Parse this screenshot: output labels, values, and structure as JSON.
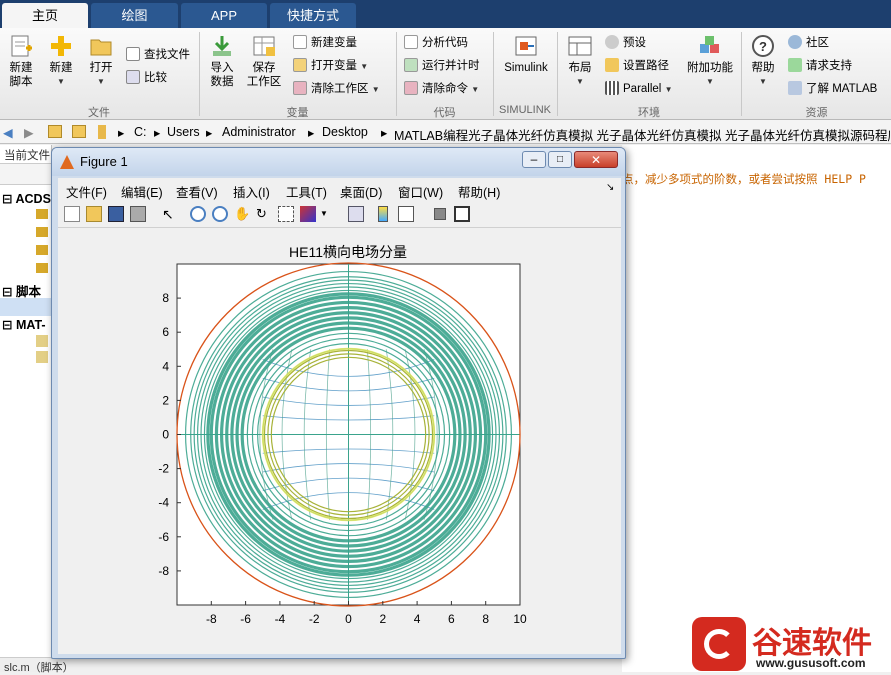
{
  "tabs": [
    "主页",
    "绘图",
    "APP",
    "快捷方式"
  ],
  "ribbon": {
    "new_script": "新建\n脚本",
    "new": "新建",
    "open": "打开",
    "find_files": "查找文件",
    "compare": "比较",
    "import_data": "导入\n数据",
    "save_workspace": "保存\n工作区",
    "new_variable": "新建变量",
    "open_variable": "打开变量",
    "clear_workspace": "清除工作区",
    "analyze_code": "分析代码",
    "run_and_time": "运行并计时",
    "clear_commands": "清除命令",
    "simulink": "Simulink",
    "layout": "布局",
    "preferences": "预设",
    "set_path": "设置路径",
    "parallel": "Parallel",
    "addons": "附加功能",
    "help": "帮助",
    "community": "社区",
    "request_support": "请求支持",
    "learn_matlab": "了解 MATLAB",
    "groups": [
      "文件",
      "变量",
      "代码",
      "SIMULINK",
      "环境",
      "资源"
    ]
  },
  "address": {
    "crumbs": [
      "C:",
      "Users",
      "Administrator",
      "Desktop",
      "MATLAB编程光子晶体光纤仿真模拟 光子晶体光纤仿真模拟 光子晶体光纤仿真模拟源码程序"
    ]
  },
  "left_panel": {
    "current_folder": "当前文件",
    "sections": [
      "ACDS",
      "脚本",
      "MAT-"
    ],
    "status": "slc.m（脚本）"
  },
  "right_area": {
    "message": "点，减少多项式的阶数，或者尝试按照 HELP P"
  },
  "figure": {
    "title": "Figure 1",
    "menu": [
      "文件(F)",
      "编辑(E)",
      "查看(V)",
      "插入(I)",
      "工具(T)",
      "桌面(D)",
      "窗口(W)",
      "帮助(H)"
    ]
  },
  "chart_data": {
    "type": "contour",
    "title": "HE11横向电场分量",
    "xlim": [
      -10,
      10
    ],
    "ylim": [
      -10,
      10
    ],
    "xticks": [
      -8,
      -6,
      -4,
      -2,
      0,
      2,
      4,
      6,
      8,
      10
    ],
    "yticks": [
      -8,
      -6,
      -4,
      -2,
      0,
      2,
      4,
      6,
      8
    ],
    "outer_circle_radius": 10,
    "ring_radii": [
      9.5,
      9.2,
      9.0,
      8.8,
      8.6,
      8.4,
      8.2,
      8.0,
      7.7,
      7.4,
      7.1,
      6.8,
      6.5,
      6.2,
      5.9,
      5.6,
      5.3,
      5.0
    ],
    "core_radius": 5.0,
    "colors": {
      "outer": "#d95319",
      "rings": "#3aa38c",
      "core_inner": "#a8b33a",
      "lines": "#1f77b4",
      "accent": "#e8e85a"
    }
  },
  "watermark": {
    "brand": "谷速软件",
    "url": "www.gususoft.com",
    "color": "#d42a1f"
  }
}
